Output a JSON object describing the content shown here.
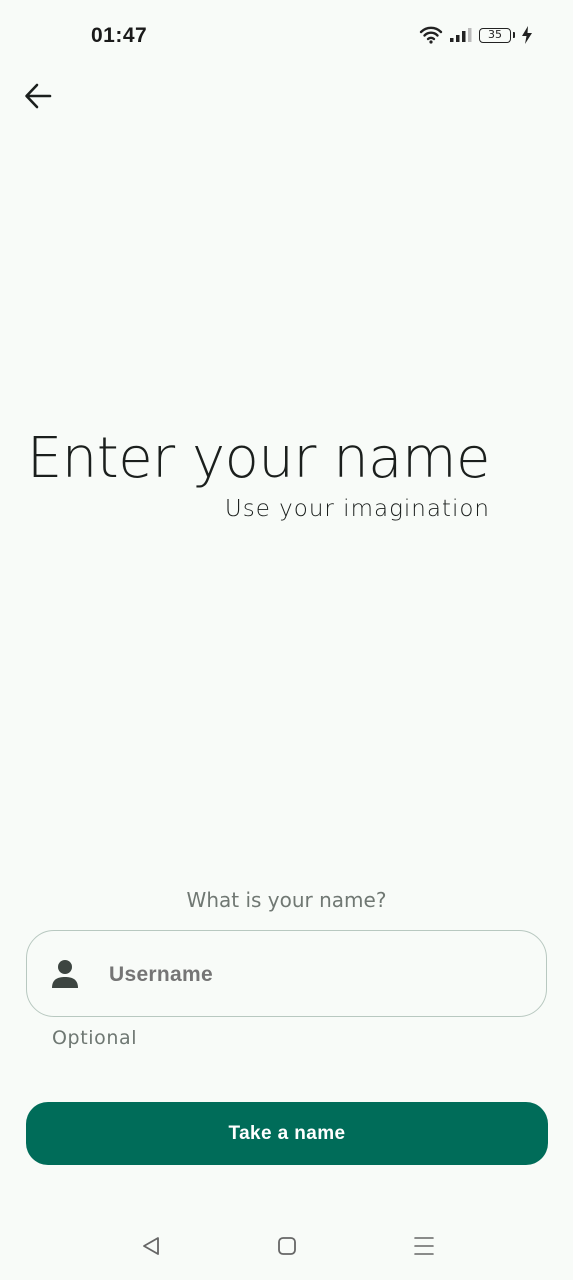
{
  "status_bar": {
    "time": "01:47",
    "battery_level": "35",
    "icons": [
      "wifi-icon",
      "signal-icon",
      "battery-icon",
      "charging-icon"
    ]
  },
  "header": {
    "back_icon": "arrow-left-icon"
  },
  "hero": {
    "title": "Enter your name",
    "subtitle": "Use your imagination"
  },
  "form": {
    "question": "What is your name?",
    "username_placeholder": "Username",
    "username_icon": "person-icon",
    "helper": "Optional",
    "submit_label": "Take a name"
  },
  "nav": {
    "icons": [
      "back-triangle-icon",
      "home-square-icon",
      "menu-lines-icon"
    ]
  },
  "colors": {
    "background": "#f8fbf8",
    "primary": "#006c59",
    "outline": "#b8c8c0"
  }
}
